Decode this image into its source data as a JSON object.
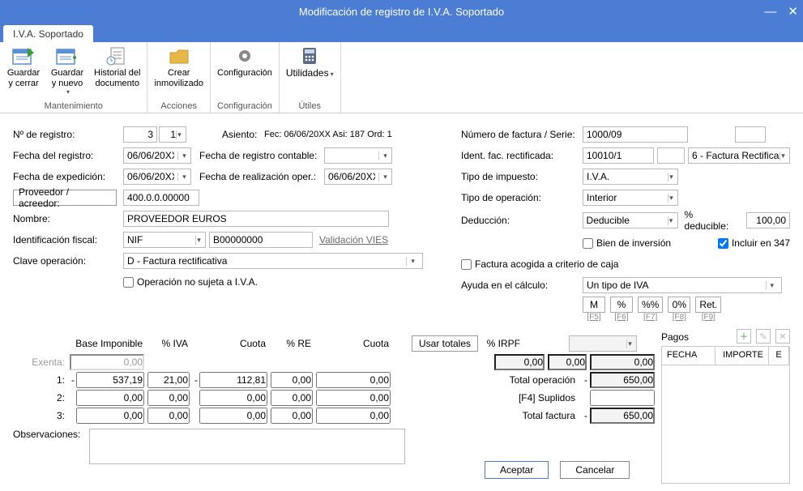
{
  "window": {
    "title": "Modificación de registro de I.V.A. Soportado"
  },
  "tab": {
    "label": "I.V.A. Soportado"
  },
  "ribbon": {
    "guardar_cerrar": "Guardar\ny cerrar",
    "guardar_nuevo": "Guardar\ny nuevo",
    "historial": "Historial del\ndocumento",
    "grp_mant": "Mantenimiento",
    "crear_inmov": "Crear\ninmovilizado",
    "grp_acciones": "Acciones",
    "config": "Configuración",
    "grp_config": "Configuración",
    "utilidades": "Utilidades",
    "grp_utiles": "Útiles"
  },
  "labels": {
    "n_registro": "Nº de registro:",
    "fecha_registro": "Fecha del registro:",
    "fecha_expedicion": "Fecha de expedición:",
    "proveedor": "Proveedor / acreedor:",
    "nombre": "Nombre:",
    "ident_fiscal": "Identificación fiscal:",
    "clave_op": "Clave operación:",
    "asiento": "Asiento:",
    "asiento_val": "Fec: 06/06/20XX Asi: 187 Ord: 1",
    "fecha_reg_cont": "Fecha de registro contable:",
    "fecha_realiz": "Fecha de realización oper.:",
    "validacion_vies": "Validación VIES",
    "op_no_sujeta": "Operación no sujeta a I.V.A.",
    "num_factura": "Número de factura / Serie:",
    "ident_rect": "Ident. fac. rectificada:",
    "tipo_impuesto": "Tipo de impuesto:",
    "tipo_operacion": "Tipo de operación:",
    "deduccion": "Deducción:",
    "pct_deducible": "% deducible:",
    "bien_inversion": "Bien de inversión",
    "incluir_347": "Incluir en 347",
    "factura_caja": "Factura acogida a criterio de caja",
    "ayuda_calculo": "Ayuda en el cálculo:",
    "observaciones": "Observaciones:",
    "base_imponible": "Base Imponible",
    "pct_iva": "% IVA",
    "cuota": "Cuota",
    "pct_re": "% RE",
    "cuota2": "Cuota",
    "usar_totales": "Usar totales",
    "pct_irpf": "% IRPF",
    "pagos": "Pagos",
    "fecha_col": "FECHA",
    "importe_col": "IMPORTE",
    "e_col": "E",
    "exenta": "Exenta:",
    "r1": "1:",
    "r2": "2:",
    "r3": "3:",
    "total_op": "Total operación",
    "suplidos": "[F4] Suplidos",
    "total_fact": "Total factura",
    "aceptar": "Aceptar",
    "cancelar": "Cancelar"
  },
  "values": {
    "n_registro": "3",
    "n_registro_sub": "1",
    "fecha_registro": "06/06/20XX",
    "fecha_expedicion": "06/06/20XX",
    "fecha_realiz": "06/06/20XX",
    "proveedor": "400.0.0.00000",
    "nombre": "PROVEEDOR EUROS",
    "ident_fiscal_tipo": "NIF",
    "ident_fiscal_num": "B00000000",
    "clave_op": "D - Factura rectificativa",
    "num_factura": "1000/09",
    "ident_rect": "10010/1",
    "rect_tipo": "6 - Factura Rectifica",
    "tipo_impuesto": "I.V.A.",
    "tipo_operacion": "Interior",
    "deduccion": "Deducible",
    "pct_deducible": "100,00",
    "incluir_347": true,
    "ayuda_calculo": "Un tipo de IVA",
    "btn_m": "M",
    "btn_pct": "%",
    "btn_pctpct": "%%",
    "btn_0pct": "0%",
    "btn_ret": "Ret.",
    "sc_f5": "[F5]",
    "sc_f6": "[F6]",
    "sc_f7": "[F7]",
    "sc_f8": "[F8]",
    "sc_f9": "[F9]",
    "exenta_val": "0,00",
    "r1_base": "537,19",
    "r1_iva": "21,00",
    "r1_cuota": "112,81",
    "r1_re": "0,00",
    "r1_cuota2": "0,00",
    "r2_base": "0,00",
    "r2_iva": "0,00",
    "r2_cuota": "0,00",
    "r2_re": "0,00",
    "r2_cuota2": "0,00",
    "r3_base": "0,00",
    "r3_iva": "0,00",
    "r3_cuota": "0,00",
    "r3_re": "0,00",
    "r3_cuota2": "0,00",
    "irpf_a": "0,00",
    "irpf_b": "0,00",
    "irpf_c": "0,00",
    "total_op": "650,00",
    "suplidos": "",
    "total_fact": "650,00",
    "neg": "-"
  }
}
